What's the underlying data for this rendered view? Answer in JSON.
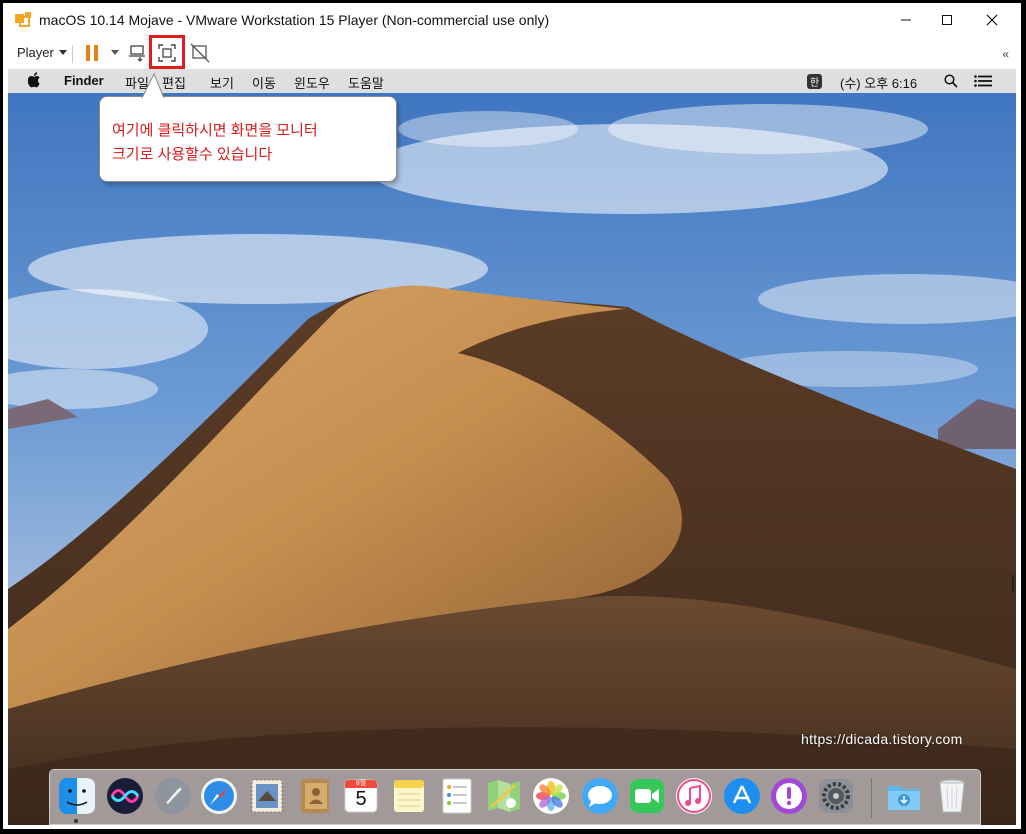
{
  "window": {
    "title": "macOS 10.14 Mojave - VMware Workstation 15 Player (Non-commercial use only)"
  },
  "toolbar": {
    "player_label": "Player",
    "icons": [
      "pause-icon",
      "send-ctrl-alt-del-icon",
      "full-screen-icon",
      "unity-icon",
      "collapse-toolbar-icon"
    ]
  },
  "mac_menubar": {
    "app_name": "Finder",
    "items": [
      "파일",
      "편집",
      "보기",
      "이동",
      "윈도우",
      "도움말"
    ],
    "input_method": "한",
    "clock": "(수) 오후 6:16"
  },
  "callout": {
    "line1": "여기에 클릭하시면 화면을 모니터",
    "line2": "크기로 사용할수 있습니다",
    "color": "#d81a1a"
  },
  "watermark": "https://dicada.tistory.com",
  "dock": {
    "apps": [
      "Finder",
      "Siri",
      "Launchpad",
      "Safari",
      "Mail",
      "Contacts",
      "Calendar",
      "Notes",
      "Reminders",
      "Maps",
      "Photos",
      "Messages",
      "FaceTime",
      "iTunes",
      "App Store",
      "Feedback Assistant",
      "System Preferences",
      "Downloads",
      "Trash"
    ],
    "calendar": {
      "month": "8월",
      "day": "5"
    }
  },
  "colors": {
    "highlight": "#e31b1b",
    "sky": "#4a7fc4",
    "dune": "#c79354"
  }
}
